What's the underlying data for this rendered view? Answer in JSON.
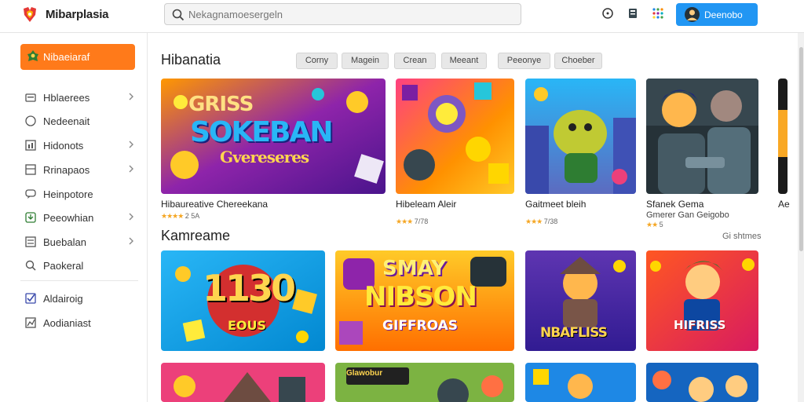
{
  "header": {
    "app_title": "Mibarplasia",
    "search_placeholder": "Nekagnamoesergeln",
    "user_label": "Deenobo"
  },
  "sidebar": {
    "primary_label": "Nibaeiaraf",
    "items": [
      {
        "label": "Hblaerees",
        "icon": "folder-icon",
        "chevron": true
      },
      {
        "label": "Nedeenait",
        "icon": "compass-icon",
        "chevron": false
      },
      {
        "label": "Hidonots",
        "icon": "chart-icon",
        "chevron": true
      },
      {
        "label": "Rrinapaos",
        "icon": "grid-icon",
        "chevron": true
      },
      {
        "label": "Heinpotore",
        "icon": "chat-icon",
        "chevron": false
      },
      {
        "label": "Peeowhian",
        "icon": "download-icon",
        "chevron": true
      },
      {
        "label": "Buebalan",
        "icon": "list-icon",
        "chevron": true
      },
      {
        "label": "Paokeral",
        "icon": "search-icon",
        "chevron": false
      },
      {
        "label": "Aldairoig",
        "icon": "check-icon",
        "chevron": false
      },
      {
        "label": "Aodianiast",
        "icon": "trend-icon",
        "chevron": false
      }
    ]
  },
  "featured": {
    "title": "Hibanatia",
    "filters": [
      "Corny",
      "Magein",
      "Crean",
      "Meeant",
      "Peeonye",
      "Choeber"
    ],
    "cards": [
      {
        "title": "Hibaureative  Chereekana",
        "rating": "2 5A",
        "stars": "★★★★",
        "art_text": "SOKEBAN",
        "art_top": "GRISS",
        "art_sub": "Gvereseres"
      },
      {
        "title": "Hibeleam Aleir",
        "rating": "7/78",
        "stars": "★★★"
      },
      {
        "title": "Gaitmeet bleih",
        "rating": "7/38",
        "stars": "★★★"
      },
      {
        "title": "Sfanek Gema",
        "subtitle": "Gmerer Gan Geigobo",
        "rating": "5",
        "stars": "★★"
      },
      {
        "title": "Ae",
        "rating": "",
        "stars": ""
      }
    ]
  },
  "second": {
    "title": "Kamreame",
    "see_all": "Gi shtmes",
    "cards": [
      {
        "art_text": "1130",
        "art_sub": "EOUS"
      },
      {
        "art_top": "SMAY",
        "art_text": "NIBSON",
        "art_sub": "GIFFROAS"
      },
      {
        "art_text": "NBAFLISS"
      },
      {
        "art_text": "HIFRISS"
      }
    ],
    "bottom_banner": "Glawobur"
  },
  "colors": {
    "accent": "#ff7a1a",
    "primary_button": "#2196f3",
    "star": "#f5a623"
  }
}
